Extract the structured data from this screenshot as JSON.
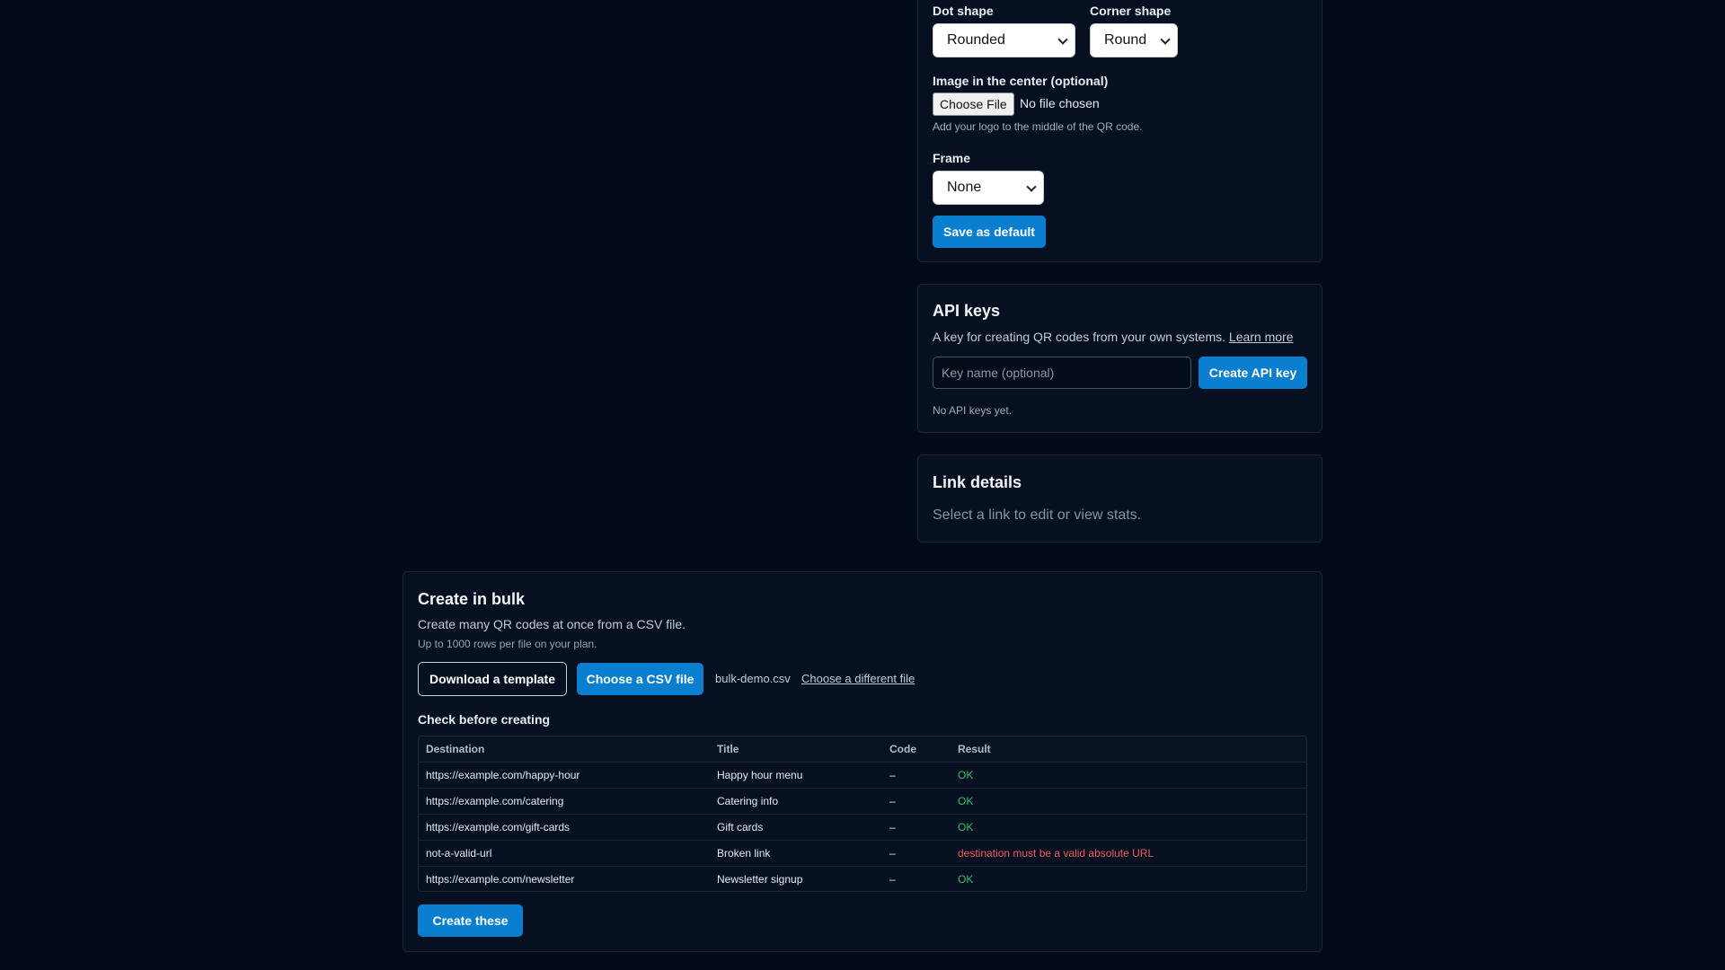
{
  "style_settings": {
    "dot_shape": {
      "label": "Dot shape",
      "value": "Rounded"
    },
    "corner_shape": {
      "label": "Corner shape",
      "value": "Round"
    },
    "center_image": {
      "label": "Image in the center (optional)",
      "button_label": "Choose File",
      "status": "No file chosen",
      "hint": "Add your logo to the middle of the QR code."
    },
    "frame": {
      "label": "Frame",
      "value": "None"
    },
    "save_label": "Save as default"
  },
  "api_keys": {
    "title": "API keys",
    "description": "A key for creating QR codes from your own systems.",
    "learn_more": "Learn more",
    "key_name_placeholder": "Key name (optional)",
    "create_label": "Create API key",
    "empty_text": "No API keys yet."
  },
  "link_details": {
    "title": "Link details",
    "placeholder": "Select a link to edit or view stats."
  },
  "bulk": {
    "title": "Create in bulk",
    "description": "Create many QR codes at once from a CSV file.",
    "limit": "Up to 1000 rows per file on your plan.",
    "download_label": "Download a template",
    "choose_label": "Choose a CSV file",
    "file_name": "bulk-demo.csv",
    "change_file": "Choose a different file",
    "check_label": "Check before creating",
    "columns": [
      "Destination",
      "Title",
      "Code",
      "Result"
    ],
    "rows": [
      {
        "destination": "https://example.com/happy-hour",
        "title": "Happy hour menu",
        "code": "–",
        "result": "OK",
        "status": "ok"
      },
      {
        "destination": "https://example.com/catering",
        "title": "Catering info",
        "code": "–",
        "result": "OK",
        "status": "ok"
      },
      {
        "destination": "https://example.com/gift-cards",
        "title": "Gift cards",
        "code": "–",
        "result": "OK",
        "status": "ok"
      },
      {
        "destination": "not-a-valid-url",
        "title": "Broken link",
        "code": "–",
        "result": "destination must be a valid absolute URL",
        "status": "error"
      },
      {
        "destination": "https://example.com/newsletter",
        "title": "Newsletter signup",
        "code": "–",
        "result": "OK",
        "status": "ok"
      }
    ],
    "create_label": "Create these"
  },
  "colors": {
    "background": "#030b19",
    "primary": "#0a7fd0",
    "ok": "#33c26b",
    "error": "#ef5c5c"
  }
}
